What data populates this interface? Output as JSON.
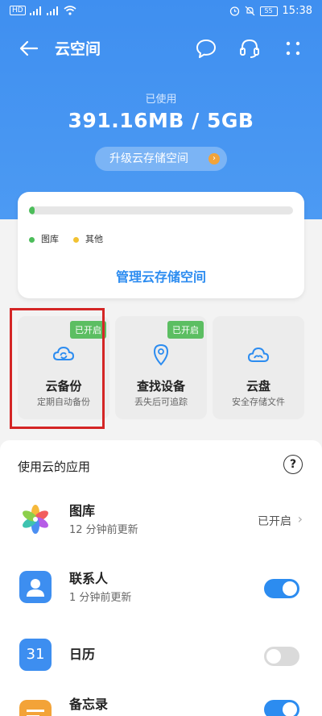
{
  "status_bar": {
    "left": "HD",
    "time": "15:38",
    "battery": "55"
  },
  "header": {
    "title": "云空间"
  },
  "storage": {
    "used_label": "已使用",
    "used_value": "391.16MB / 5GB",
    "usage_fraction": 0.02,
    "upgrade_label": "升级云存储空间",
    "legend": [
      {
        "label": "图库",
        "color": "#4cbd5a"
      },
      {
        "label": "其他",
        "color": "#f2c232"
      }
    ],
    "manage_label": "管理云存储空间"
  },
  "features": [
    {
      "name": "云备份",
      "sub": "定期自动备份",
      "badge": "已开启",
      "icon": "cloud-sync-icon"
    },
    {
      "name": "查找设备",
      "sub": "丢失后可追踪",
      "badge": "已开启",
      "icon": "locate-device-icon"
    },
    {
      "name": "云盘",
      "sub": "安全存储文件",
      "badge": "",
      "icon": "cloud-drive-icon"
    }
  ],
  "apps": {
    "heading": "使用云的应用",
    "help_symbol": "?",
    "items": [
      {
        "name": "图库",
        "sub": "12 分钟前更新",
        "status": "已开启",
        "icon": "gallery-icon"
      },
      {
        "name": "联系人",
        "sub": "1 分钟前更新",
        "toggle": "on",
        "icon": "contacts-icon"
      },
      {
        "name": "日历",
        "sub": "",
        "toggle": "off",
        "icon": "calendar-icon",
        "icon_text": "31"
      },
      {
        "name": "备忘录",
        "sub": "",
        "toggle": "on",
        "icon": "notes-icon"
      }
    ]
  },
  "colors": {
    "accent": "#2c8cf0",
    "header_bg": "#4593f1",
    "enabled_badge": "#5cbe62",
    "highlight_box": "#d42525"
  }
}
